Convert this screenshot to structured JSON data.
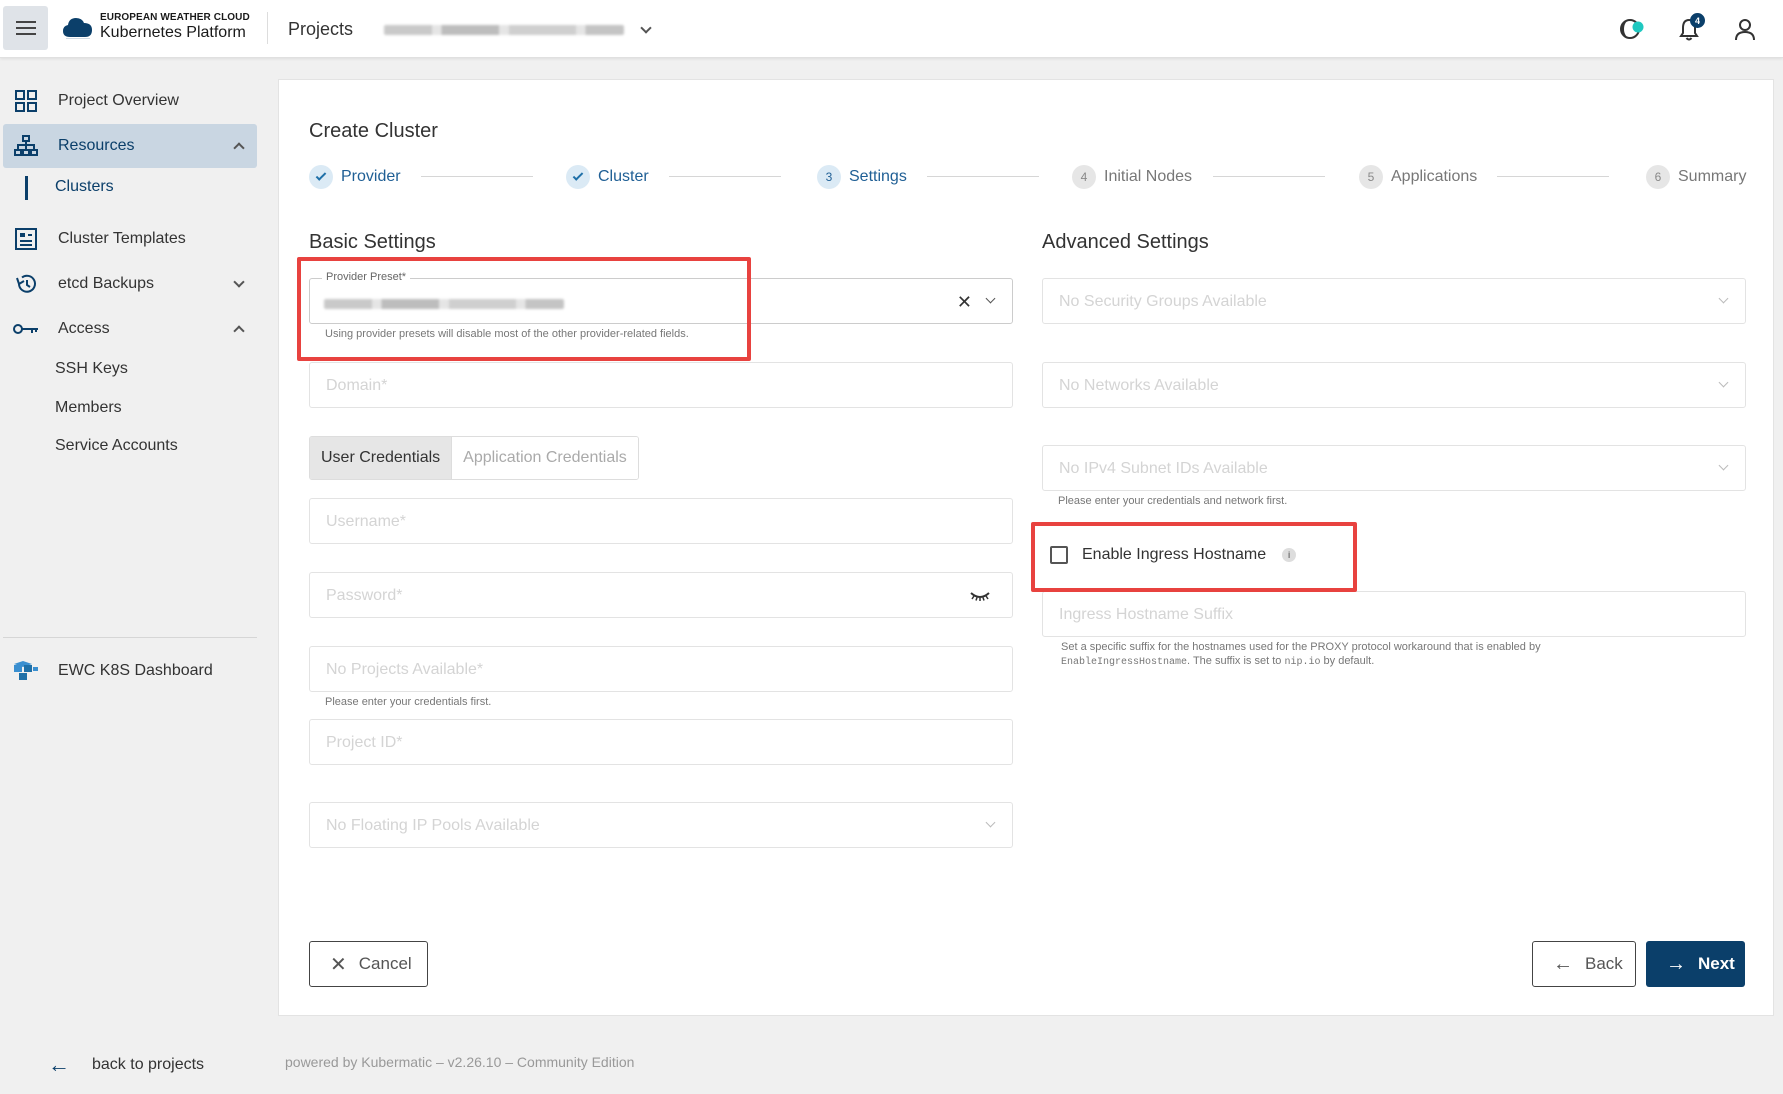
{
  "brand": {
    "line1": "EUROPEAN WEATHER CLOUD",
    "line2": "Kubernetes Platform"
  },
  "header": {
    "projects_label": "Projects",
    "notification_count": "4"
  },
  "sidebar": {
    "items": [
      {
        "label": "Project Overview"
      },
      {
        "label": "Resources"
      },
      {
        "label": "Clusters"
      },
      {
        "label": "Cluster Templates"
      },
      {
        "label": "etcd Backups"
      },
      {
        "label": "Access"
      },
      {
        "label": "SSH Keys"
      },
      {
        "label": "Members"
      },
      {
        "label": "Service Accounts"
      },
      {
        "label": "EWC K8S Dashboard"
      }
    ],
    "back_label": "back to projects"
  },
  "main": {
    "title": "Create Cluster",
    "steps": [
      {
        "label": "Provider",
        "num": ""
      },
      {
        "label": "Cluster",
        "num": ""
      },
      {
        "label": "Settings",
        "num": "3"
      },
      {
        "label": "Initial Nodes",
        "num": "4"
      },
      {
        "label": "Applications",
        "num": "5"
      },
      {
        "label": "Summary",
        "num": "6"
      }
    ],
    "basic": {
      "title": "Basic Settings",
      "provider_preset_label": "Provider Preset*",
      "provider_preset_hint": "Using provider presets will disable most of the other provider-related fields.",
      "domain_ph": "Domain*",
      "tab_user": "User Credentials",
      "tab_app": "Application Credentials",
      "username_ph": "Username*",
      "password_ph": "Password*",
      "projects_ph": "No Projects Available*",
      "projects_hint": "Please enter your credentials first.",
      "project_id_ph": "Project ID*",
      "floating_ph": "No Floating IP Pools Available"
    },
    "advanced": {
      "title": "Advanced Settings",
      "security_ph": "No Security Groups Available",
      "networks_ph": "No Networks Available",
      "subnet_ph": "No IPv4 Subnet IDs Available",
      "subnet_hint": "Please enter your credentials and network first.",
      "ingress_label": "Enable Ingress Hostname",
      "ingress_suffix_ph": "Ingress Hostname Suffix",
      "suffix_hint_1": "Set a specific suffix for the hostnames used for the PROXY protocol workaround that is enabled by",
      "suffix_hint_code1": "EnableIngressHostname",
      "suffix_hint_2": ". The suffix is set to ",
      "suffix_hint_code2": "nip.io",
      "suffix_hint_3": " by default."
    },
    "buttons": {
      "cancel": "Cancel",
      "back": "Back",
      "next": "Next"
    }
  },
  "footer": {
    "text": "powered by Kubermatic –  v2.26.10 –  Community Edition"
  },
  "colors": {
    "primary": "#0b3f6a",
    "highlight": "#e8423f",
    "active_bg": "#c9d6e2"
  }
}
